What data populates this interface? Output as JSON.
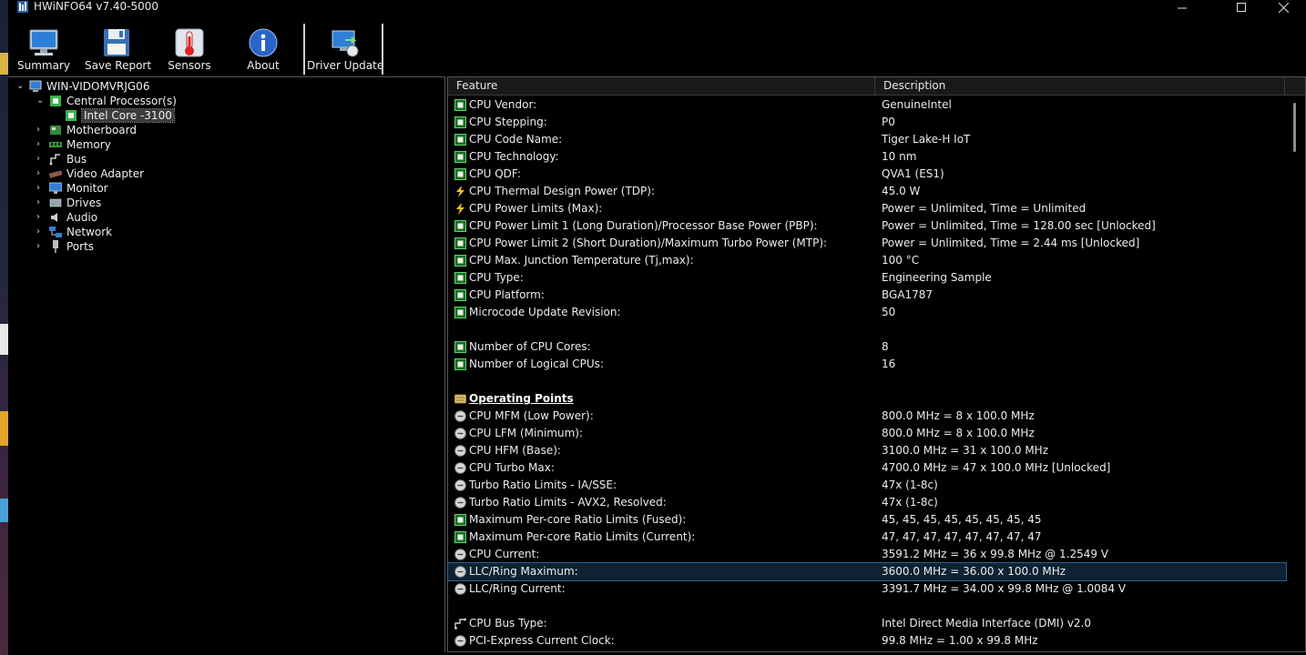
{
  "window": {
    "title": "HWiNFO64 v7.40-5000",
    "controls": [
      "minimize-icon",
      "maximize-icon",
      "close-icon"
    ]
  },
  "toolbar": {
    "buttons": [
      {
        "label": "Summary",
        "icon": "monitor-icon"
      },
      {
        "label": "Save Report",
        "icon": "floppy-disk-icon"
      },
      {
        "label": "Sensors",
        "icon": "thermometer-icon"
      },
      {
        "label": "About",
        "icon": "info-icon"
      },
      {
        "label": "Driver Update",
        "icon": "driver-update-icon"
      }
    ]
  },
  "tree": {
    "root": "WIN-VIDOMVRJG06",
    "items": [
      {
        "label": "Central Processor(s)",
        "expanded": true
      },
      {
        "label": "Intel Core -3100",
        "selected": true
      },
      {
        "label": "Motherboard"
      },
      {
        "label": "Memory"
      },
      {
        "label": "Bus"
      },
      {
        "label": "Video Adapter"
      },
      {
        "label": "Monitor"
      },
      {
        "label": "Drives"
      },
      {
        "label": "Audio"
      },
      {
        "label": "Network"
      },
      {
        "label": "Ports"
      }
    ]
  },
  "table": {
    "columns": [
      "Feature",
      "Description"
    ],
    "rows": [
      {
        "icon": "chip",
        "feature": "CPU Vendor:",
        "description": "GenuineIntel"
      },
      {
        "icon": "chip",
        "feature": "CPU Stepping:",
        "description": "P0"
      },
      {
        "icon": "chip",
        "feature": "CPU Code Name:",
        "description": "Tiger Lake-H IoT"
      },
      {
        "icon": "chip",
        "feature": "CPU Technology:",
        "description": "10 nm"
      },
      {
        "icon": "chip",
        "feature": "CPU QDF:",
        "description": "QVA1 (ES1)"
      },
      {
        "icon": "bolt",
        "feature": "CPU Thermal Design Power (TDP):",
        "description": "45.0 W"
      },
      {
        "icon": "bolt",
        "feature": "CPU Power Limits (Max):",
        "description": "Power = Unlimited, Time = Unlimited"
      },
      {
        "icon": "chip",
        "feature": "CPU Power Limit 1 (Long Duration)/Processor Base Power (PBP):",
        "description": "Power = Unlimited, Time = 128.00 sec [Unlocked]"
      },
      {
        "icon": "chip",
        "feature": "CPU Power Limit 2 (Short Duration)/Maximum Turbo Power (MTP):",
        "description": "Power = Unlimited, Time = 2.44 ms [Unlocked]"
      },
      {
        "icon": "chip",
        "feature": "CPU Max. Junction Temperature (Tj,max):",
        "description": "100 °C"
      },
      {
        "icon": "chip",
        "feature": "CPU Type:",
        "description": "Engineering Sample"
      },
      {
        "icon": "chip",
        "feature": "CPU Platform:",
        "description": "BGA1787"
      },
      {
        "icon": "chip",
        "feature": "Microcode Update Revision:",
        "description": "50"
      },
      {
        "icon": "",
        "feature": "",
        "description": ""
      },
      {
        "icon": "chip",
        "feature": "Number of CPU Cores:",
        "description": "8"
      },
      {
        "icon": "chip",
        "feature": "Number of Logical CPUs:",
        "description": "16"
      },
      {
        "icon": "",
        "feature": "",
        "description": ""
      },
      {
        "icon": "section",
        "feature": "Operating Points",
        "description": "",
        "section": true
      },
      {
        "icon": "clock",
        "feature": "CPU MFM (Low Power):",
        "description": "800.0 MHz = 8 x 100.0 MHz"
      },
      {
        "icon": "clock",
        "feature": "CPU LFM (Minimum):",
        "description": "800.0 MHz = 8 x 100.0 MHz"
      },
      {
        "icon": "clock",
        "feature": "CPU HFM (Base):",
        "description": "3100.0 MHz = 31 x 100.0 MHz"
      },
      {
        "icon": "clock",
        "feature": "CPU Turbo Max:",
        "description": "4700.0 MHz = 47 x 100.0 MHz [Unlocked]"
      },
      {
        "icon": "clock",
        "feature": "Turbo Ratio Limits - IA/SSE:",
        "description": "47x (1-8c)"
      },
      {
        "icon": "clock",
        "feature": "Turbo Ratio Limits - AVX2, Resolved:",
        "description": "47x (1-8c)"
      },
      {
        "icon": "chip",
        "feature": "Maximum Per-core Ratio Limits (Fused):",
        "description": "45, 45, 45, 45, 45, 45, 45, 45"
      },
      {
        "icon": "chip",
        "feature": "Maximum Per-core Ratio Limits (Current):",
        "description": "47, 47, 47, 47, 47, 47, 47, 47"
      },
      {
        "icon": "clock",
        "feature": "CPU Current:",
        "description": "3591.2 MHz = 36 x 99.8 MHz @ 1.2549 V"
      },
      {
        "icon": "clock",
        "feature": "LLC/Ring Maximum:",
        "description": "3600.0 MHz = 36.00 x 100.0 MHz",
        "selected": true
      },
      {
        "icon": "clock",
        "feature": "LLC/Ring Current:",
        "description": "3391.7 MHz = 34.00 x 99.8 MHz @ 1.0084 V"
      },
      {
        "icon": "",
        "feature": "",
        "description": ""
      },
      {
        "icon": "bus",
        "feature": "CPU Bus Type:",
        "description": "Intel Direct Media Interface (DMI) v2.0"
      },
      {
        "icon": "clock",
        "feature": "PCI-Express Current Clock:",
        "description": "99.8 MHz = 1.00 x 99.8 MHz"
      }
    ]
  },
  "colors": {
    "background": "#000000",
    "selection": "#0f2233",
    "selection_border": "#2f5f8a",
    "chip_green": "#3bb34a",
    "bolt_yellow": "#f5c518"
  }
}
